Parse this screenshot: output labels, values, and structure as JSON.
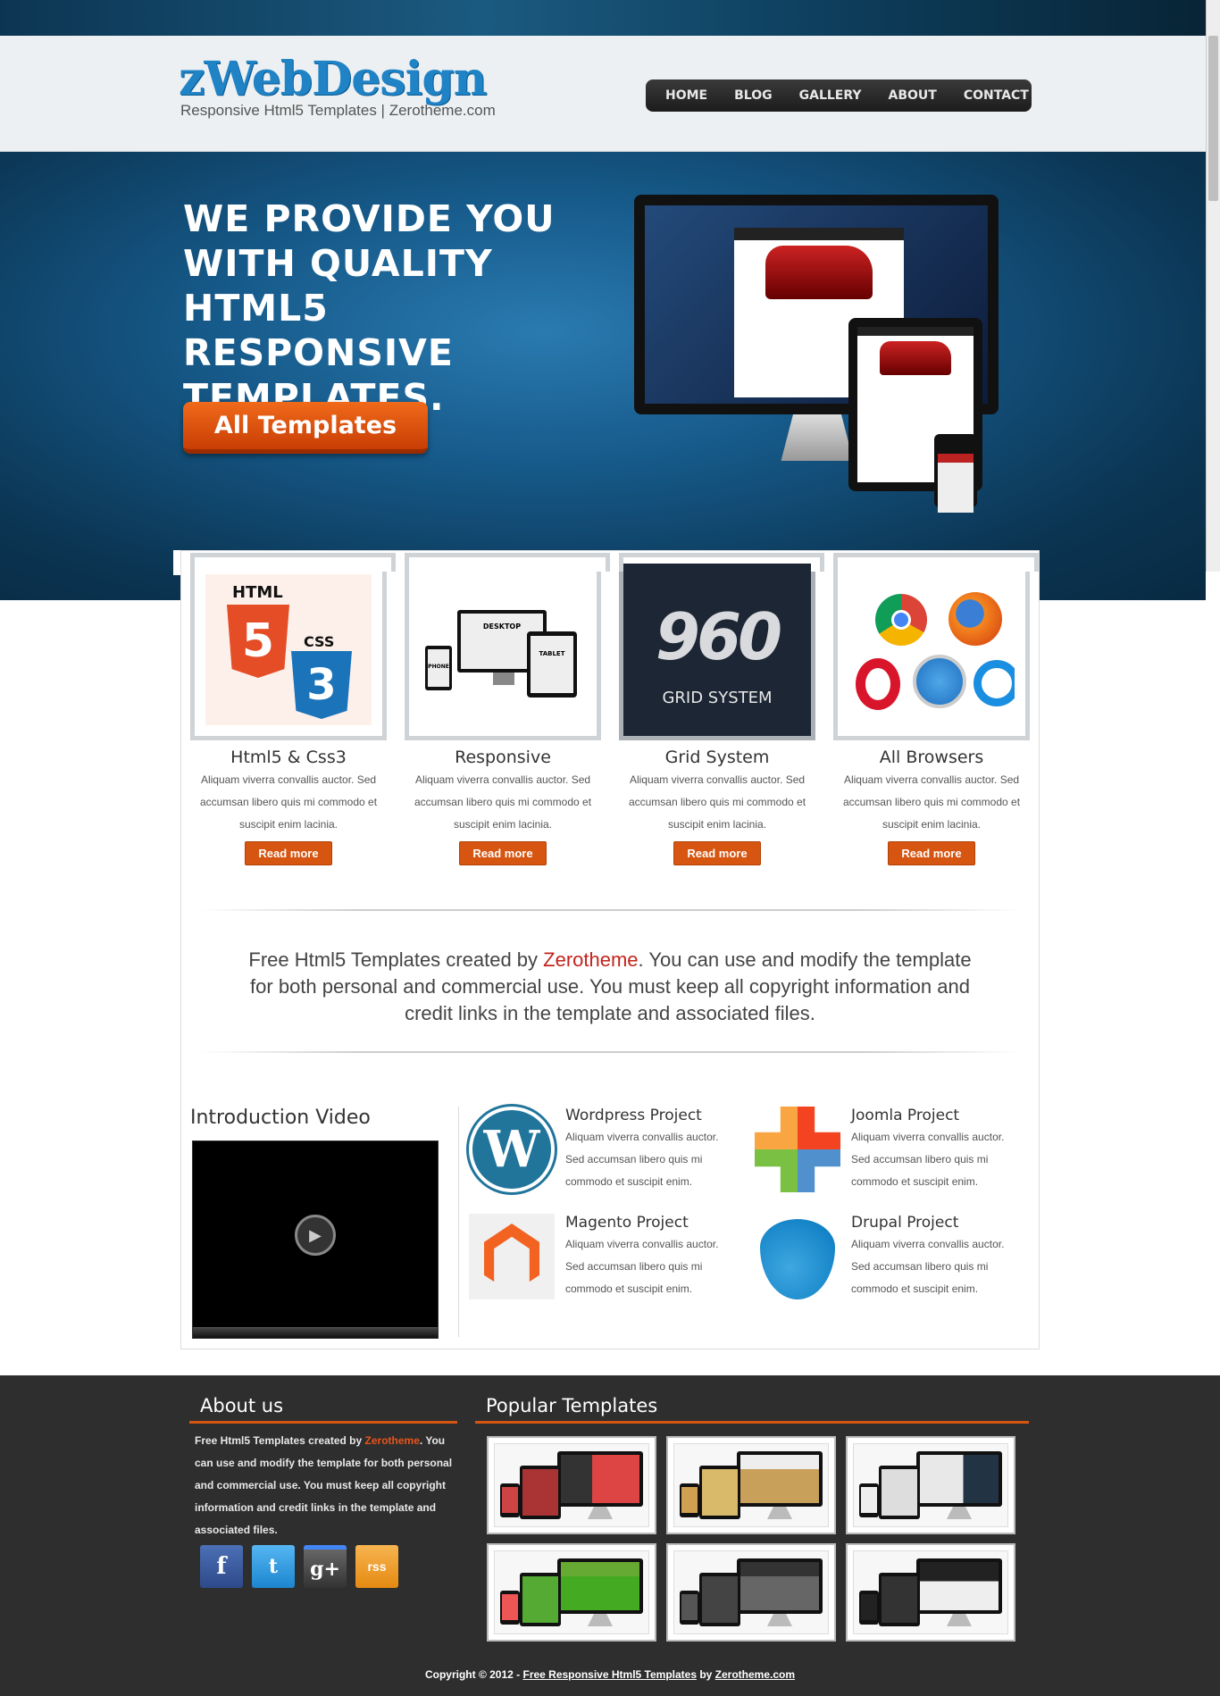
{
  "header": {
    "logo_title": "zWebDesign",
    "logo_subtitle": "Responsive Html5 Templates | Zerotheme.com",
    "nav": [
      "HOME",
      "BLOG",
      "GALLERY",
      "ABOUT",
      "CONTACT"
    ]
  },
  "hero": {
    "title": "WE PROVIDE YOU WITH QUALITY HTML5 RESPONSIVE TEMPLATES.",
    "button_label": "All Templates"
  },
  "features": [
    {
      "title": "Html5 & Css3",
      "text": "Aliquam viverra convallis auctor. Sed accumsan libero quis mi commodo et suscipit enim lacinia.",
      "button": "Read more",
      "icon": "html5-css3-icon"
    },
    {
      "title": "Responsive",
      "text": "Aliquam viverra convallis auctor. Sed accumsan libero quis mi commodo et suscipit enim lacinia.",
      "button": "Read more",
      "icon": "responsive-devices-icon"
    },
    {
      "title": "Grid System",
      "text": "Aliquam viverra convallis auctor. Sed accumsan libero quis mi commodo et suscipit enim lacinia.",
      "button": "Read more",
      "icon": "960-grid-icon"
    },
    {
      "title": "All Browsers",
      "text": "Aliquam viverra convallis auctor. Sed accumsan libero quis mi commodo et suscipit enim lacinia.",
      "button": "Read more",
      "icon": "browsers-icon"
    }
  ],
  "feature_images": {
    "html": "HTML",
    "css": "CSS",
    "five": "5",
    "three": "3",
    "desktop": "DESKTOP",
    "tablet": "TABLET",
    "phone": "PHONE",
    "grid_number": "960",
    "grid_text": "GRID SYSTEM"
  },
  "notice": {
    "before": "Free Html5 Templates created by ",
    "link": "Zerotheme",
    "after": ". You can use and modify the template for both personal and commercial use. You must keep all copyright information and credit links in the template and associated files."
  },
  "intro": {
    "title": "Introduction Video"
  },
  "projects": [
    {
      "title": "Wordpress Project",
      "text": "Aliquam viverra convallis auctor. Sed accumsan libero quis mi commodo et suscipit enim.",
      "icon": "wordpress-icon"
    },
    {
      "title": "Joomla Project",
      "text": "Aliquam viverra convallis auctor. Sed accumsan libero quis mi commodo et suscipit enim.",
      "icon": "joomla-icon"
    },
    {
      "title": "Magento Project",
      "text": "Aliquam viverra convallis auctor. Sed accumsan libero quis mi commodo et suscipit enim.",
      "icon": "magento-icon"
    },
    {
      "title": "Drupal Project",
      "text": "Aliquam viverra convallis auctor. Sed accumsan libero quis mi commodo et suscipit enim.",
      "icon": "drupal-icon"
    }
  ],
  "footer": {
    "about_title": "About us",
    "about_before": "Free Html5 Templates created by ",
    "about_link": "Zerotheme",
    "about_after": ". You can use and modify the template for both personal and commercial use. You must keep all copyright information and credit links in the template and associated files.",
    "social": [
      {
        "label": "f",
        "icon": "facebook-icon",
        "color": "#3b5998"
      },
      {
        "label": "t",
        "icon": "twitter-icon",
        "color": "#2aa3ef"
      },
      {
        "label": "g+",
        "icon": "google-plus-icon",
        "color": "#555555"
      },
      {
        "label": "rss",
        "icon": "rss-icon",
        "color": "#f0a030"
      }
    ],
    "popular_title": "Popular Templates",
    "copyright_before": "Copyright © 2012 - ",
    "copyright_link": "Free Responsive Html5 Templates",
    "copyright_mid": " by ",
    "copyright_link2": "Zerotheme.com"
  },
  "colors": {
    "accent": "#d65511",
    "brand_blue": "#1f83c6",
    "link_red": "#c3231b"
  }
}
